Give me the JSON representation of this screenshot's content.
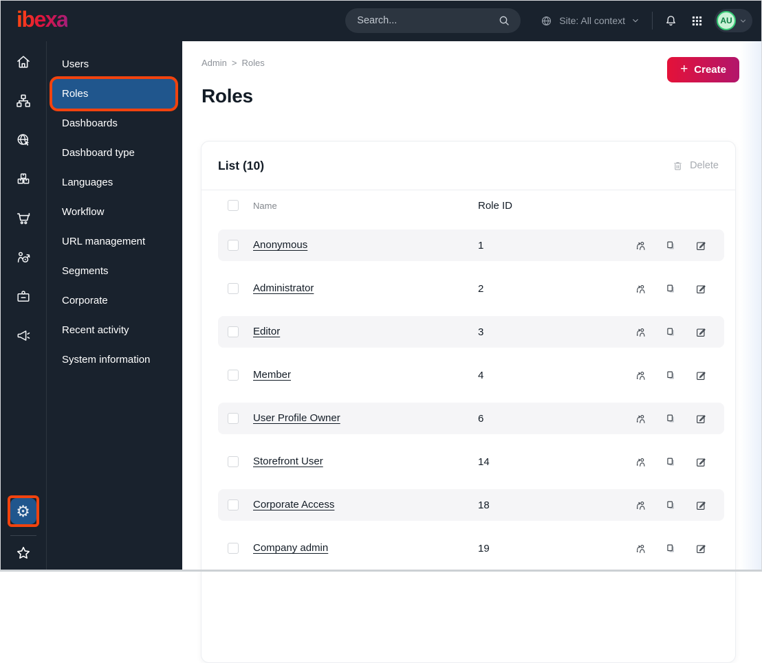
{
  "topbar": {
    "logo": "ibexa",
    "search_placeholder": "Search...",
    "site_context": "Site: All context",
    "avatar_initials": "AU"
  },
  "rail": {
    "icons": [
      "home-icon",
      "content-tree-icon",
      "site-globe-icon",
      "products-boxes-icon",
      "cart-icon",
      "target-audience-icon",
      "id-badge-icon",
      "megaphone-icon",
      "gear-icon",
      "star-icon"
    ]
  },
  "sidebar": {
    "items": [
      {
        "label": "Users",
        "active": false
      },
      {
        "label": "Roles",
        "active": true
      },
      {
        "label": "Dashboards",
        "active": false
      },
      {
        "label": "Dashboard type",
        "active": false
      },
      {
        "label": "Languages",
        "active": false
      },
      {
        "label": "Workflow",
        "active": false
      },
      {
        "label": "URL management",
        "active": false
      },
      {
        "label": "Segments",
        "active": false
      },
      {
        "label": "Corporate",
        "active": false
      },
      {
        "label": "Recent activity",
        "active": false
      },
      {
        "label": "System information",
        "active": false
      }
    ]
  },
  "breadcrumb": {
    "items": [
      "Admin",
      "Roles"
    ],
    "separator": ">"
  },
  "page": {
    "title": "Roles",
    "create_label": "Create",
    "create_plus": "+"
  },
  "list": {
    "title": "List (10)",
    "delete_label": "Delete",
    "columns": [
      "Name",
      "Role ID"
    ],
    "row_action_icons": [
      "assign-users-icon",
      "copy-icon",
      "edit-icon"
    ],
    "rows": [
      {
        "name": "Anonymous",
        "role_id": "1"
      },
      {
        "name": "Administrator",
        "role_id": "2"
      },
      {
        "name": "Editor",
        "role_id": "3"
      },
      {
        "name": "Member",
        "role_id": "4"
      },
      {
        "name": "User Profile Owner",
        "role_id": "6"
      },
      {
        "name": "Storefront User",
        "role_id": "14"
      },
      {
        "name": "Corporate Access",
        "role_id": "18"
      },
      {
        "name": "Company admin",
        "role_id": "19"
      }
    ]
  },
  "colors": {
    "topbar_bg": "#19222d",
    "selected_blue": "#20568d",
    "highlight_orange": "#f1430e",
    "create_gradient_start": "#e41239",
    "create_gradient_end": "#b2156b",
    "row_stripe": "#f5f5f7",
    "avatar_green": "#35cb75",
    "gear_icon_glyph": "⚙",
    "star_icon_glyph": "☆"
  }
}
